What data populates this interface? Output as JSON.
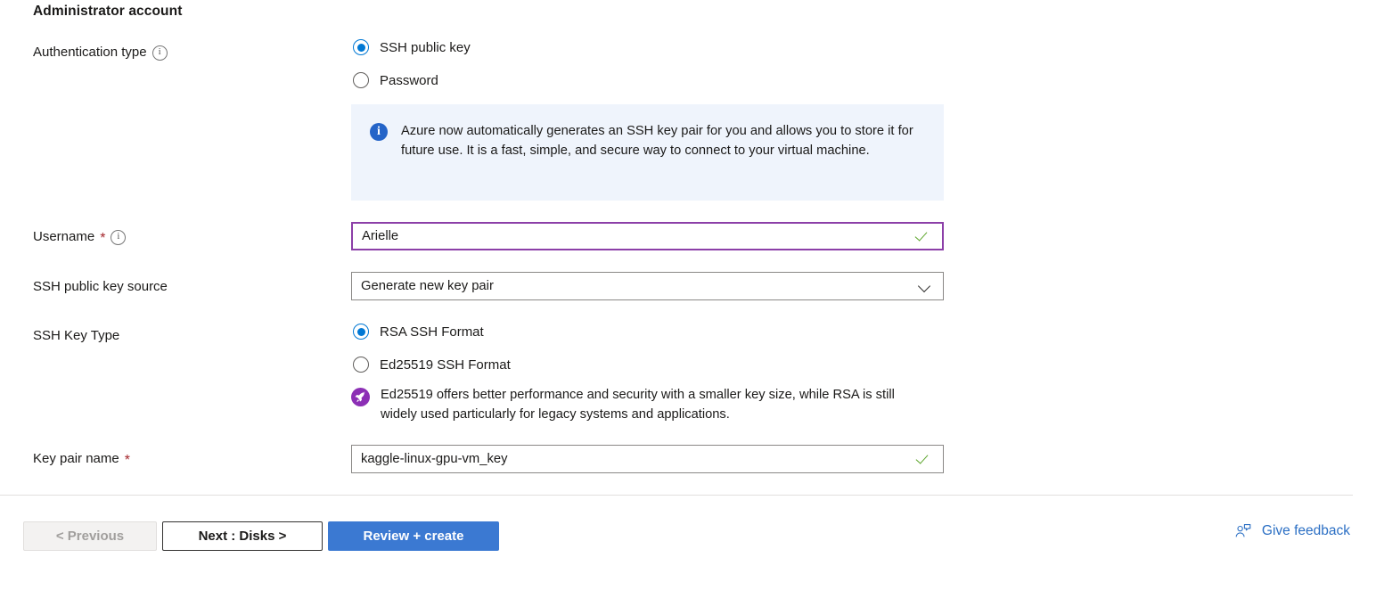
{
  "section": {
    "title": "Administrator account"
  },
  "fields": {
    "authentication_type": {
      "label": "Authentication type",
      "info_icon": "info-circle-icon",
      "options": [
        {
          "label": "SSH public key",
          "selected": true
        },
        {
          "label": "Password",
          "selected": false
        }
      ]
    },
    "info_banner": {
      "icon": "info-filled-icon",
      "text": "Azure now automatically generates an SSH key pair for you and allows you to store it for future use. It is a fast, simple, and secure way to connect to your virtual machine."
    },
    "username": {
      "label": "Username",
      "required_marker": "*",
      "info_icon": "info-circle-icon",
      "value": "Arielle",
      "validation_icon": "checkmark-icon",
      "focused": true
    },
    "ssh_public_key_source": {
      "label": "SSH public key source",
      "value": "Generate new key pair",
      "chevron_icon": "chevron-down-icon"
    },
    "ssh_key_type": {
      "label": "SSH Key Type",
      "options": [
        {
          "label": "RSA SSH Format",
          "selected": true
        },
        {
          "label": "Ed25519 SSH Format",
          "selected": false
        }
      ],
      "hint_icon": "rocket-icon",
      "hint": "Ed25519 offers better performance and security with a smaller key size, while RSA is still widely used particularly for legacy systems and applications."
    },
    "key_pair_name": {
      "label": "Key pair name",
      "required_marker": "*",
      "value": "kaggle-linux-gpu-vm_key",
      "validation_icon": "checkmark-icon"
    }
  },
  "footer": {
    "previous_button": "< Previous",
    "next_button": "Next : Disks >",
    "review_button": "Review + create",
    "feedback_label": "Give feedback",
    "feedback_icon": "person-feedback-icon"
  },
  "colors": {
    "accent_blue": "#0078d4",
    "primary_button": "#3b79d2",
    "focus_purple": "#8c3fa8",
    "validation_green": "#5ca52b",
    "required_red": "#a4262c",
    "banner_background": "#eff4fc",
    "rocket_purple": "#8c2fb5",
    "link_blue": "#2b6fc4"
  }
}
